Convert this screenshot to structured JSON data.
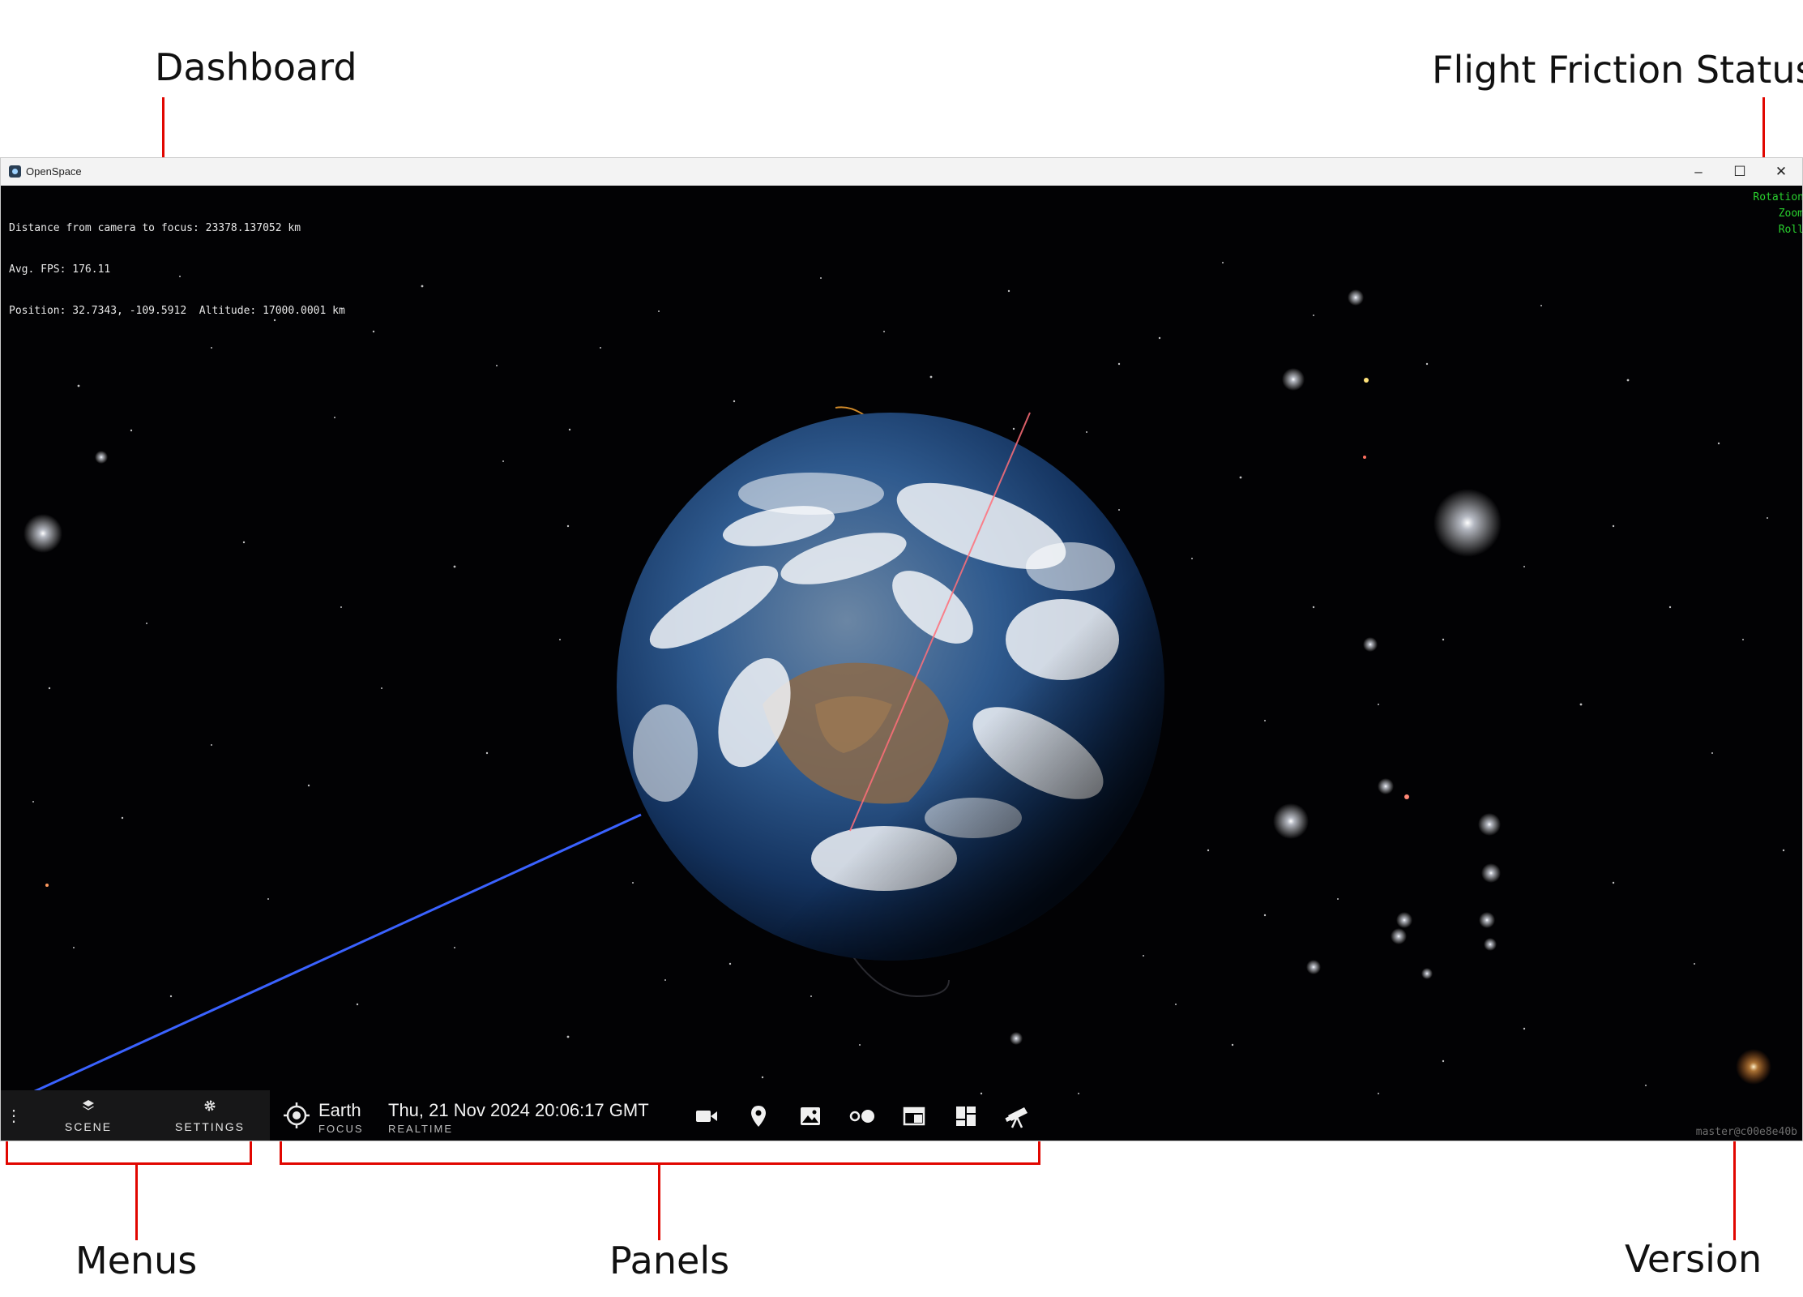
{
  "annotations": {
    "dashboard": "Dashboard",
    "flight_friction_status": "Flight Friction Status",
    "menus": "Menus",
    "panels": "Panels",
    "version": "Version"
  },
  "window": {
    "title": "OpenSpace",
    "controls": {
      "minimize": "–",
      "maximize": "☐",
      "close": "✕"
    }
  },
  "dashboard": {
    "lines": [
      "Distance from camera to focus: 23378.137052 km",
      "Avg. FPS: 176.11",
      "Position: 32.7343, -109.5912  Altitude: 17000.0001 km"
    ]
  },
  "flight_friction": {
    "labels": [
      "Rotation",
      "Zoom",
      "Roll"
    ],
    "color": "#29d12e"
  },
  "version": "master@c00e8e40b",
  "menus": {
    "more_icon": "more-vertical-icon",
    "scene": {
      "label": "SCENE",
      "icon": "layers-icon"
    },
    "settings": {
      "label": "SETTINGS",
      "icon": "gear-icon"
    }
  },
  "panels": {
    "focus": {
      "name": "Earth",
      "sub": "FOCUS",
      "icon": "target-icon"
    },
    "time": {
      "value": "Thu, 21 Nov 2024 20:06:17 GMT",
      "sub": "REALTIME"
    },
    "buttons": [
      "video-camera-icon",
      "map-pin-icon",
      "image-icon",
      "toggle-dots-icon",
      "browser-window-icon",
      "dashboard-grid-icon",
      "telescope-icon"
    ]
  },
  "colors": {
    "annotation_lines": "#e10600",
    "orbit_blue": "#3a62ff",
    "orbit_red": "#ff6f7a",
    "orbit_orange": "#d08a2a"
  }
}
